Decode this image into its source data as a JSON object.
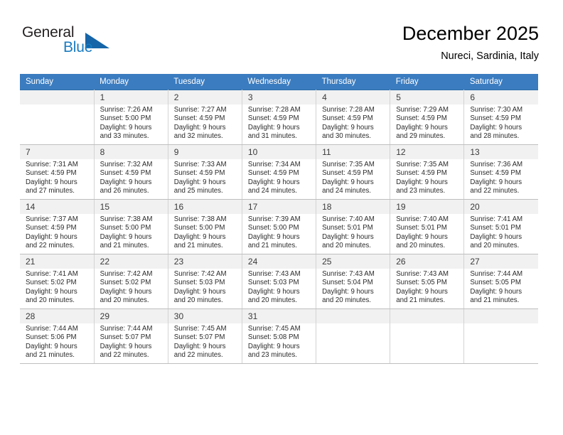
{
  "brand": {
    "name_top": "General",
    "name_bottom": "Blue",
    "logo_icon": "blue-triangle-logo",
    "colors": {
      "blue": "#1a7cc1",
      "dark": "#231f20",
      "triangle": "#1565a8"
    }
  },
  "header": {
    "title": "December 2025",
    "subtitle": "Nureci, Sardinia, Italy"
  },
  "calendar": {
    "header_bg": "#3b7cc0",
    "weekday_headers": [
      "Sunday",
      "Monday",
      "Tuesday",
      "Wednesday",
      "Thursday",
      "Friday",
      "Saturday"
    ],
    "weeks": [
      [
        {
          "day": "",
          "lines": []
        },
        {
          "day": "1",
          "lines": [
            "Sunrise: 7:26 AM",
            "Sunset: 5:00 PM",
            "Daylight: 9 hours",
            "and 33 minutes."
          ]
        },
        {
          "day": "2",
          "lines": [
            "Sunrise: 7:27 AM",
            "Sunset: 4:59 PM",
            "Daylight: 9 hours",
            "and 32 minutes."
          ]
        },
        {
          "day": "3",
          "lines": [
            "Sunrise: 7:28 AM",
            "Sunset: 4:59 PM",
            "Daylight: 9 hours",
            "and 31 minutes."
          ]
        },
        {
          "day": "4",
          "lines": [
            "Sunrise: 7:28 AM",
            "Sunset: 4:59 PM",
            "Daylight: 9 hours",
            "and 30 minutes."
          ]
        },
        {
          "day": "5",
          "lines": [
            "Sunrise: 7:29 AM",
            "Sunset: 4:59 PM",
            "Daylight: 9 hours",
            "and 29 minutes."
          ]
        },
        {
          "day": "6",
          "lines": [
            "Sunrise: 7:30 AM",
            "Sunset: 4:59 PM",
            "Daylight: 9 hours",
            "and 28 minutes."
          ]
        }
      ],
      [
        {
          "day": "7",
          "lines": [
            "Sunrise: 7:31 AM",
            "Sunset: 4:59 PM",
            "Daylight: 9 hours",
            "and 27 minutes."
          ]
        },
        {
          "day": "8",
          "lines": [
            "Sunrise: 7:32 AM",
            "Sunset: 4:59 PM",
            "Daylight: 9 hours",
            "and 26 minutes."
          ]
        },
        {
          "day": "9",
          "lines": [
            "Sunrise: 7:33 AM",
            "Sunset: 4:59 PM",
            "Daylight: 9 hours",
            "and 25 minutes."
          ]
        },
        {
          "day": "10",
          "lines": [
            "Sunrise: 7:34 AM",
            "Sunset: 4:59 PM",
            "Daylight: 9 hours",
            "and 24 minutes."
          ]
        },
        {
          "day": "11",
          "lines": [
            "Sunrise: 7:35 AM",
            "Sunset: 4:59 PM",
            "Daylight: 9 hours",
            "and 24 minutes."
          ]
        },
        {
          "day": "12",
          "lines": [
            "Sunrise: 7:35 AM",
            "Sunset: 4:59 PM",
            "Daylight: 9 hours",
            "and 23 minutes."
          ]
        },
        {
          "day": "13",
          "lines": [
            "Sunrise: 7:36 AM",
            "Sunset: 4:59 PM",
            "Daylight: 9 hours",
            "and 22 minutes."
          ]
        }
      ],
      [
        {
          "day": "14",
          "lines": [
            "Sunrise: 7:37 AM",
            "Sunset: 4:59 PM",
            "Daylight: 9 hours",
            "and 22 minutes."
          ]
        },
        {
          "day": "15",
          "lines": [
            "Sunrise: 7:38 AM",
            "Sunset: 5:00 PM",
            "Daylight: 9 hours",
            "and 21 minutes."
          ]
        },
        {
          "day": "16",
          "lines": [
            "Sunrise: 7:38 AM",
            "Sunset: 5:00 PM",
            "Daylight: 9 hours",
            "and 21 minutes."
          ]
        },
        {
          "day": "17",
          "lines": [
            "Sunrise: 7:39 AM",
            "Sunset: 5:00 PM",
            "Daylight: 9 hours",
            "and 21 minutes."
          ]
        },
        {
          "day": "18",
          "lines": [
            "Sunrise: 7:40 AM",
            "Sunset: 5:01 PM",
            "Daylight: 9 hours",
            "and 20 minutes."
          ]
        },
        {
          "day": "19",
          "lines": [
            "Sunrise: 7:40 AM",
            "Sunset: 5:01 PM",
            "Daylight: 9 hours",
            "and 20 minutes."
          ]
        },
        {
          "day": "20",
          "lines": [
            "Sunrise: 7:41 AM",
            "Sunset: 5:01 PM",
            "Daylight: 9 hours",
            "and 20 minutes."
          ]
        }
      ],
      [
        {
          "day": "21",
          "lines": [
            "Sunrise: 7:41 AM",
            "Sunset: 5:02 PM",
            "Daylight: 9 hours",
            "and 20 minutes."
          ]
        },
        {
          "day": "22",
          "lines": [
            "Sunrise: 7:42 AM",
            "Sunset: 5:02 PM",
            "Daylight: 9 hours",
            "and 20 minutes."
          ]
        },
        {
          "day": "23",
          "lines": [
            "Sunrise: 7:42 AM",
            "Sunset: 5:03 PM",
            "Daylight: 9 hours",
            "and 20 minutes."
          ]
        },
        {
          "day": "24",
          "lines": [
            "Sunrise: 7:43 AM",
            "Sunset: 5:03 PM",
            "Daylight: 9 hours",
            "and 20 minutes."
          ]
        },
        {
          "day": "25",
          "lines": [
            "Sunrise: 7:43 AM",
            "Sunset: 5:04 PM",
            "Daylight: 9 hours",
            "and 20 minutes."
          ]
        },
        {
          "day": "26",
          "lines": [
            "Sunrise: 7:43 AM",
            "Sunset: 5:05 PM",
            "Daylight: 9 hours",
            "and 21 minutes."
          ]
        },
        {
          "day": "27",
          "lines": [
            "Sunrise: 7:44 AM",
            "Sunset: 5:05 PM",
            "Daylight: 9 hours",
            "and 21 minutes."
          ]
        }
      ],
      [
        {
          "day": "28",
          "lines": [
            "Sunrise: 7:44 AM",
            "Sunset: 5:06 PM",
            "Daylight: 9 hours",
            "and 21 minutes."
          ]
        },
        {
          "day": "29",
          "lines": [
            "Sunrise: 7:44 AM",
            "Sunset: 5:07 PM",
            "Daylight: 9 hours",
            "and 22 minutes."
          ]
        },
        {
          "day": "30",
          "lines": [
            "Sunrise: 7:45 AM",
            "Sunset: 5:07 PM",
            "Daylight: 9 hours",
            "and 22 minutes."
          ]
        },
        {
          "day": "31",
          "lines": [
            "Sunrise: 7:45 AM",
            "Sunset: 5:08 PM",
            "Daylight: 9 hours",
            "and 23 minutes."
          ]
        },
        {
          "day": "",
          "lines": []
        },
        {
          "day": "",
          "lines": []
        },
        {
          "day": "",
          "lines": []
        }
      ]
    ]
  }
}
